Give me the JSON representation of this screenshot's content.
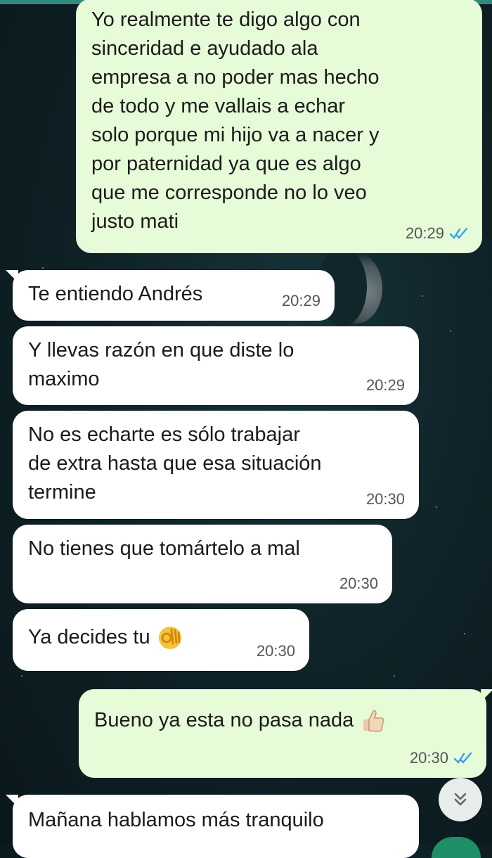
{
  "messages": [
    {
      "direction": "out",
      "text": "Yo realmente te digo algo con\nsinceridad e ayudado ala\nempresa a no poder mas hecho\nde todo y me vallais a echar\nsolo porque mi hijo va a nacer y\npor paternidad ya que es algo\nque me corresponde no lo veo\njusto mati",
      "time": "20:29",
      "status": "read"
    },
    {
      "direction": "in",
      "text": "Te entiendo Andrés",
      "time": "20:29"
    },
    {
      "direction": "in",
      "text": "Y llevas razón en que diste lo\nmaximo",
      "time": "20:29"
    },
    {
      "direction": "in",
      "text": "No es echarte es sólo trabajar\nde extra hasta que esa situación\ntermine",
      "time": "20:30"
    },
    {
      "direction": "in",
      "text": "No tienes que tomártelo a mal",
      "time": "20:30"
    },
    {
      "direction": "in",
      "text": "Ya decides tu",
      "emoji": "ok-hand-emoji",
      "time": "20:30"
    },
    {
      "direction": "out",
      "text": "Bueno ya esta no pasa nada",
      "emoji": "thumbs-up-emoji",
      "time": "20:30",
      "status": "read"
    },
    {
      "direction": "in",
      "text": "Mañana hablamos más tranquilo",
      "time": ""
    }
  ],
  "colors": {
    "incoming_bubble": "#ffffff",
    "outgoing_bubble": "#e6fbd8",
    "read_tick": "#3b9ee8",
    "background": "#0f2328"
  },
  "icons": {
    "scroll_down": "double-chevron-down-icon",
    "read_receipt": "double-check-icon"
  }
}
